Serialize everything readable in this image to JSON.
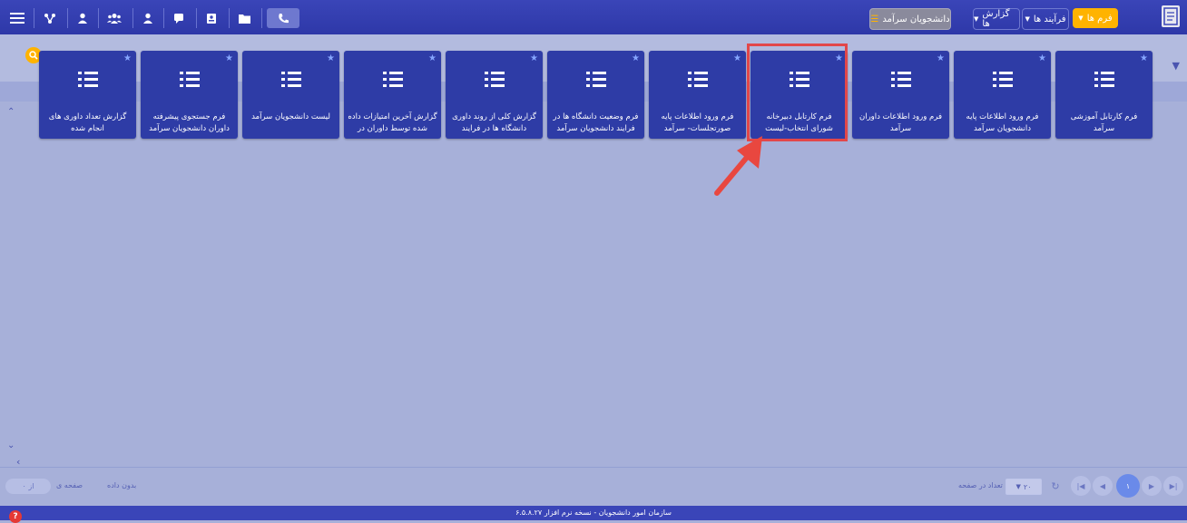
{
  "topbar": {
    "tabs": [
      {
        "label": "فرم ها",
        "active": true
      },
      {
        "label": "فرآیند ها",
        "active": false
      },
      {
        "label": "گزارش ها",
        "active": false
      }
    ],
    "app_button": "دانشجویان سرآمد",
    "icons": [
      "hamburger-menu-icon",
      "org-chart-icon",
      "user-icon",
      "users-group-icon",
      "user-icon",
      "comment-icon",
      "id-badge-icon",
      "folder-icon",
      "phone-icon"
    ]
  },
  "tiles": [
    {
      "title": "فرم کارتابل آموزشی سرآمد"
    },
    {
      "title": "فرم ورود اطلاعات پایه دانشجویان سرآمد"
    },
    {
      "title": "فرم ورود اطلاعات داوران سرآمد"
    },
    {
      "title": "فرم کارتابل دبیرخانه شورای انتخاب-لیست"
    },
    {
      "title": "فرم ورود اطلاعات پایه صورتجلسات- سرآمد"
    },
    {
      "title": "فرم وضعیت دانشگاه ها در فرایند دانشجویان سرآمد"
    },
    {
      "title": "گزارش کلی از روند داوری دانشگاه ها در فرایند"
    },
    {
      "title": "گزارش آخرین امتیازات داده شده توسط داوران در"
    },
    {
      "title": "لیست دانشجویان سرآمد"
    },
    {
      "title": "فرم جستجوی پیشرفته داوران دانشجویان سرآمد"
    },
    {
      "title": "گزارش تعداد داوری های انجام شده"
    }
  ],
  "pager": {
    "page_size": "۲۰",
    "page_size_label": "تعداد در صفحه",
    "page_label": "صفحه ی",
    "page_of": "از ۰",
    "no_data": "بدون داده",
    "current_page": "۱"
  },
  "footer": {
    "text": "سازمان امور دانشجویان - نسخه نرم افزار ۶.۵.۸.۲۷"
  },
  "colors": {
    "accent": "#ffb300",
    "topbar": "#3a45b8",
    "tile": "#2e3ca6",
    "highlight": "#e2474a",
    "arrow": "#e9473f"
  }
}
